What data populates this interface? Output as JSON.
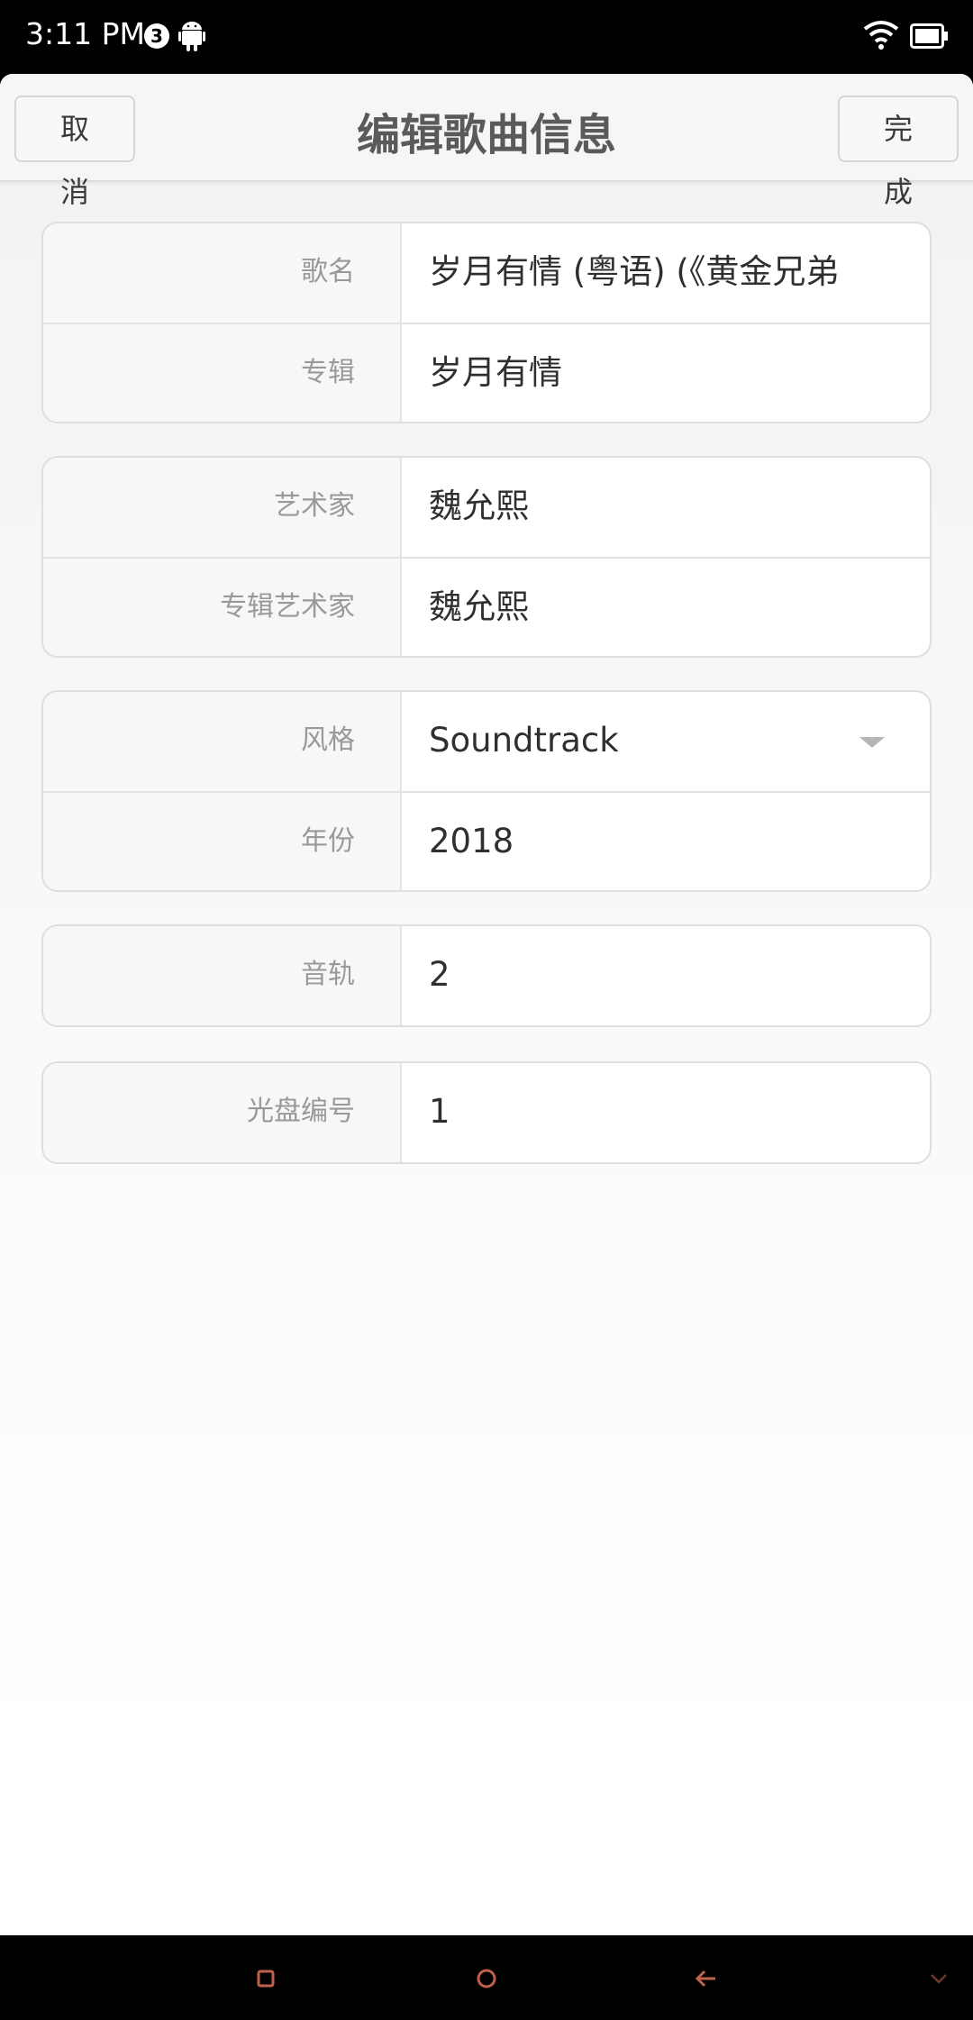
{
  "status_bar": {
    "time": "3:11 PM",
    "notification_count": "3",
    "icons": [
      "android-icon",
      "wifi-icon",
      "battery-icon"
    ]
  },
  "header": {
    "cancel_label": "取消",
    "title": "编辑歌曲信息",
    "done_label": "完成"
  },
  "groups": [
    {
      "rows": [
        {
          "label": "歌名",
          "value": "岁月有情 (粤语) (《黄金兄弟"
        },
        {
          "label": "专辑",
          "value": "岁月有情"
        }
      ]
    },
    {
      "rows": [
        {
          "label": "艺术家",
          "value": "魏允熙"
        },
        {
          "label": "专辑艺术家",
          "value": "魏允熙"
        }
      ]
    },
    {
      "rows": [
        {
          "label": "风格",
          "value": "Soundtrack"
        },
        {
          "label": "年份",
          "value": "2018"
        }
      ]
    },
    {
      "rows": [
        {
          "label": "音轨",
          "value": "2"
        }
      ]
    },
    {
      "rows": [
        {
          "label": "光盘编号",
          "value": "1"
        }
      ]
    }
  ],
  "nav_bar": {
    "icons": [
      "recent-apps-icon",
      "home-icon",
      "back-icon",
      "hide-nav-icon"
    ],
    "accent_color": "#c0624a"
  }
}
